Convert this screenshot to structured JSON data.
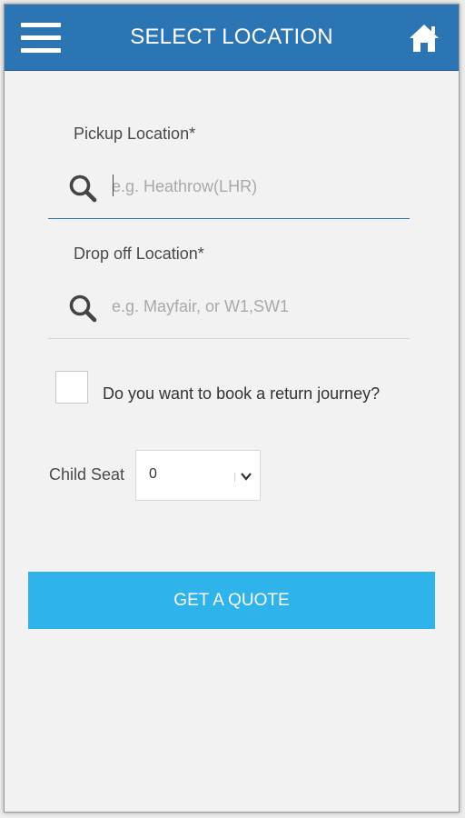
{
  "header": {
    "title": "SELECT LOCATION",
    "menu_icon": "hamburger-menu-icon",
    "home_icon": "home-icon",
    "color": "#2c75b4"
  },
  "pickup": {
    "label": "Pickup Location*",
    "placeholder": "e.g. Heathrow(LHR)",
    "value": "",
    "icon": "search-icon"
  },
  "dropoff": {
    "label": "Drop off Location*",
    "placeholder": "e.g. Mayfair, or W1,SW1",
    "value": "",
    "icon": "search-icon"
  },
  "return_journey": {
    "label": "Do you want to book a return journey?",
    "checked": false
  },
  "child_seat": {
    "label": "Child Seat",
    "selected": "0"
  },
  "actions": {
    "quote_label": "GET A QUOTE",
    "quote_color": "#2eb3ea"
  }
}
